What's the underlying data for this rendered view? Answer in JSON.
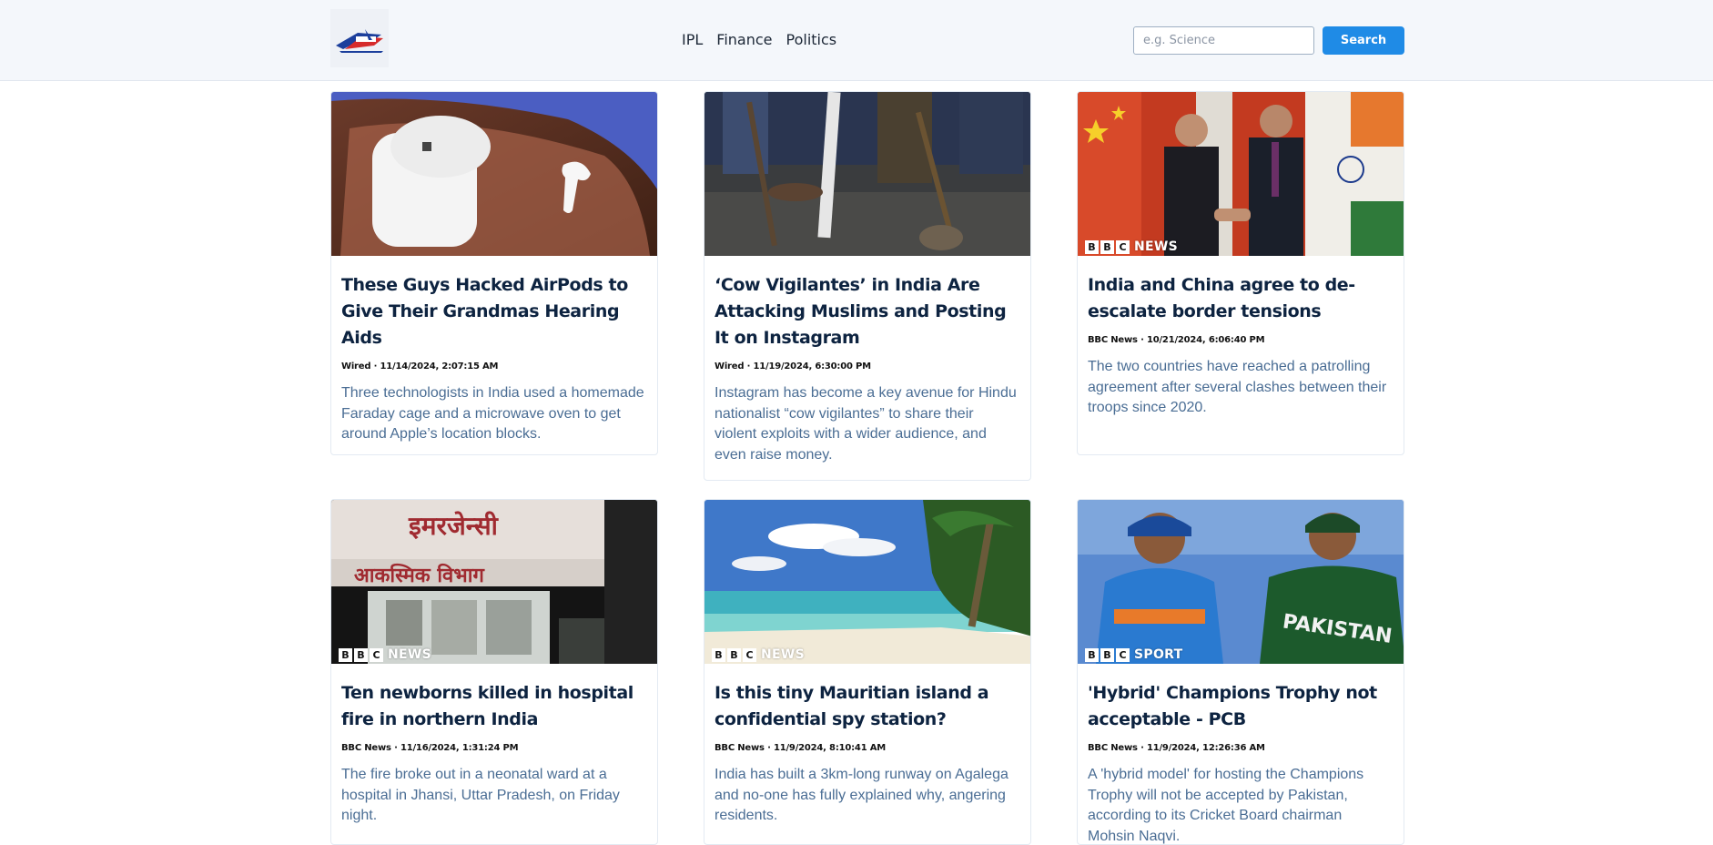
{
  "header": {
    "logo_label": "News app logo",
    "nav": [
      "IPL",
      "Finance",
      "Politics"
    ],
    "search": {
      "placeholder": "e.g. Science",
      "button_label": "Search"
    }
  },
  "articles": [
    {
      "title": "These Guys Hacked AirPods to Give Their Grandmas Hearing Aids",
      "meta": "Wired · 11/14/2024, 2:07:15 AM",
      "description": "Three technologists in India used a homemade Faraday cage and a microwave oven to get around Apple’s location blocks.",
      "image": "airpods-in-hand-photo",
      "badge": ""
    },
    {
      "title": "‘Cow Vigilantes’ in India Are Attacking Muslims and Posting It on Instagram",
      "meta": "Wired · 11/19/2024, 6:30:00 PM",
      "description": "Instagram has become a key avenue for Hindu nationalist “cow vigilantes” to share their violent exploits with a wider audience, and even raise money.",
      "image": "crowd-with-sticks-photo",
      "badge": ""
    },
    {
      "title": "India and China agree to de-escalate border tensions",
      "meta": "BBC News · 10/21/2024, 6:06:40 PM",
      "description": "The two countries have reached a patrolling agreement after several clashes between their troops since 2020.",
      "image": "leaders-handshake-photo",
      "badge": "NEWS"
    },
    {
      "title": "Ten newborns killed in hospital fire in northern India",
      "meta": "BBC News · 11/16/2024, 1:31:24 PM",
      "description": "The fire broke out in a neonatal ward at a hospital in Jhansi, Uttar Pradesh, on Friday night.",
      "image": "hospital-emergency-entrance-photo",
      "badge": "NEWS",
      "sign_line_1": "इमरजेन्सी",
      "sign_line_2": "आकस्मिक विभाग"
    },
    {
      "title": "Is this tiny Mauritian island a confidential spy station?",
      "meta": "BBC News · 11/9/2024, 8:10:41 AM",
      "description": "India has built a 3km-long runway on Agalega and no-one has fully explained why, angering residents.",
      "image": "tropical-beach-photo",
      "badge": "NEWS"
    },
    {
      "title": "'Hybrid' Champions Trophy not acceptable - PCB",
      "meta": "BBC News · 11/9/2024, 12:26:36 AM",
      "description": "A 'hybrid model' for hosting the Champions Trophy will not be accepted by Pakistan, according to its Cricket Board chairman Mohsin Naqvi.",
      "image": "cricket-captains-photo",
      "badge": "SPORT",
      "jersey_text": "PAKISTAN"
    }
  ]
}
